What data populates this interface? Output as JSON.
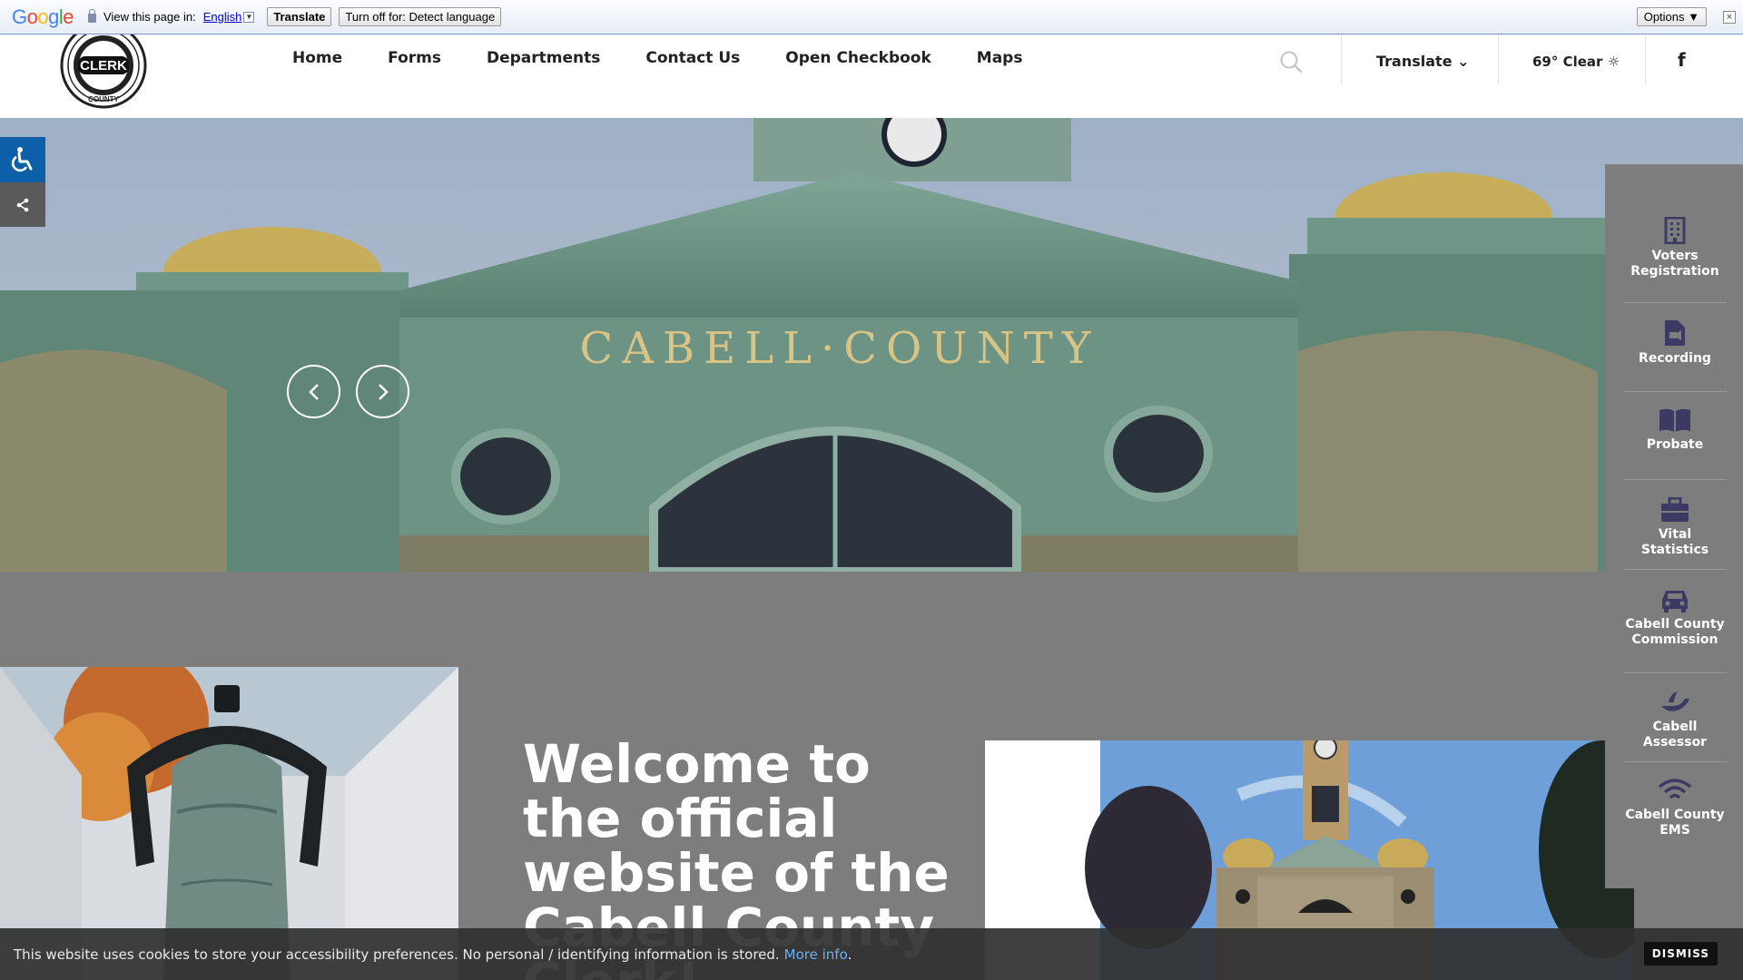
{
  "translate_bar": {
    "prompt": "View this page in:",
    "language": "English",
    "translate_button": "Translate",
    "turn_off_button": "Turn off for: Detect language",
    "options_button": "Options ▼",
    "close": "×"
  },
  "header": {
    "logo_text": "CLERK",
    "logo_ring_top": "CABELL",
    "logo_ring_bottom": "COUNTY",
    "nav": [
      "Home",
      "Forms",
      "Departments",
      "Contact Us",
      "Open Checkbook",
      "Maps"
    ],
    "translate_label": "Translate ⌄",
    "weather": "69° Clear ☼",
    "facebook": "f"
  },
  "hero": {
    "building_sign": "CABELL·COUNTY"
  },
  "quick_links": [
    {
      "label": "Voters Registration",
      "icon": "building-icon"
    },
    {
      "label": "Recording",
      "icon": "file-video-icon"
    },
    {
      "label": "Probate",
      "icon": "book-icon"
    },
    {
      "label": "Vital Statistics",
      "icon": "briefcase-icon"
    },
    {
      "label": "Cabell County Commission",
      "icon": "car-icon"
    },
    {
      "label": "Cabell Assessor",
      "icon": "hand-icon"
    },
    {
      "label": "Cabell County EMS",
      "icon": "wifi-icon"
    }
  ],
  "welcome": {
    "heading": "Welcome to the official website of the Cabell County Clerk!"
  },
  "cookie": {
    "message": "This website uses cookies to store your accessibility preferences. No personal / identifying information is stored.",
    "more_info": "More info",
    "period": ".",
    "dismiss": "DISMISS"
  },
  "colors": {
    "accessibility_blue": "#0d5fa7",
    "quick_link_panel": "#7d7d7d",
    "page_background": "#7d7d7d",
    "cookie_bar": "#303030",
    "link_blue": "#6ab0f3"
  }
}
